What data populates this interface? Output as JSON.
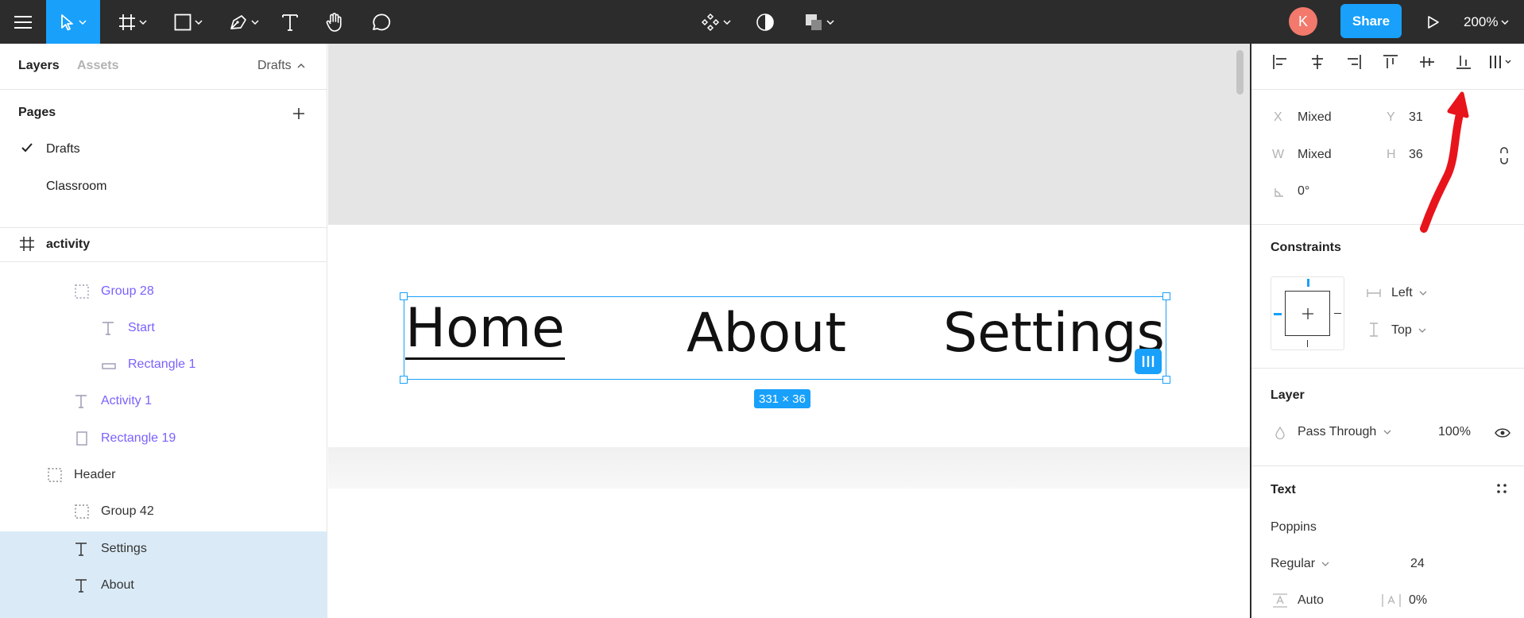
{
  "toolbar": {
    "share_label": "Share",
    "avatar_initial": "K",
    "zoom_label": "200%"
  },
  "left_panel": {
    "tabs": [
      "Layers",
      "Assets"
    ],
    "pages_dropdown": "Drafts",
    "pages_title": "Pages",
    "pages": [
      "Drafts",
      "Classroom"
    ],
    "current_frame": "activity",
    "layers": [
      {
        "name": "Group 28",
        "type": "group"
      },
      {
        "name": "Start",
        "type": "text"
      },
      {
        "name": "Rectangle 1",
        "type": "rectangle"
      },
      {
        "name": "Activity 1",
        "type": "text"
      },
      {
        "name": "Rectangle 19",
        "type": "rectangle"
      },
      {
        "name": "Header",
        "type": "group"
      },
      {
        "name": "Group 42",
        "type": "group"
      },
      {
        "name": "Settings",
        "type": "text"
      },
      {
        "name": "About",
        "type": "text"
      }
    ]
  },
  "canvas": {
    "nav_items": [
      "Home",
      "About",
      "Settings"
    ],
    "selection_size": "331 × 36"
  },
  "right_panel": {
    "x_label": "X",
    "x_value": "Mixed",
    "y_label": "Y",
    "y_value": "31",
    "w_label": "W",
    "w_value": "Mixed",
    "h_label": "H",
    "h_value": "36",
    "rotation": "0°",
    "constraints_title": "Constraints",
    "constraint_h": "Left",
    "constraint_v": "Top",
    "layer_title": "Layer",
    "blend_mode": "Pass Through",
    "opacity": "100%",
    "text_title": "Text",
    "font_family": "Poppins",
    "font_weight": "Regular",
    "font_size": "24",
    "line_height": "Auto",
    "letter_spacing": "0%"
  },
  "colors": {
    "toolbar_bg": "#2c2c2c",
    "accent": "#18a0fb",
    "avatar": "#f2796b",
    "annotation_arrow": "#e8141c",
    "component_purple": "#7b61ff"
  }
}
